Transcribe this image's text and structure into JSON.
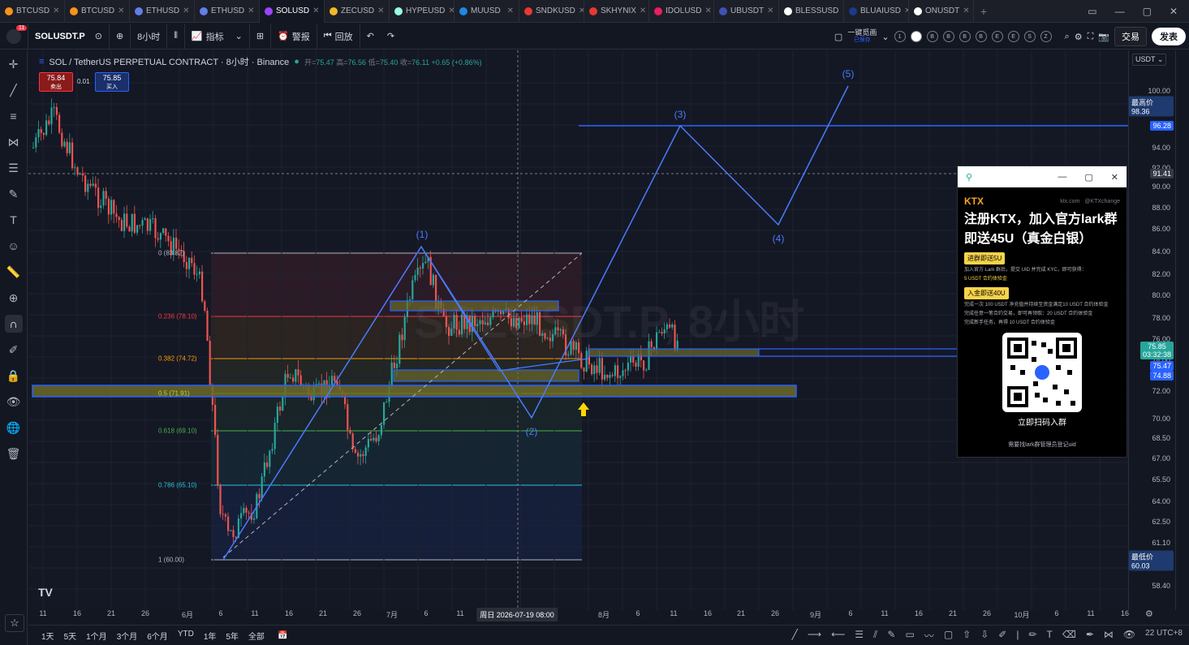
{
  "tabs": [
    {
      "label": "BTCUSD",
      "color": "#f7931a"
    },
    {
      "label": "BTCUSD",
      "color": "#f7931a"
    },
    {
      "label": "ETHUSD",
      "color": "#627eea"
    },
    {
      "label": "ETHUSD",
      "color": "#627eea"
    },
    {
      "label": "SOLUSD",
      "color": "#9945ff"
    },
    {
      "label": "ZECUSD",
      "color": "#f4b728"
    },
    {
      "label": "HYPEUSD",
      "color": "#97fce4"
    },
    {
      "label": "MUUSD",
      "color": "#1e88e5"
    },
    {
      "label": "SNDKUSD",
      "color": "#e53935"
    },
    {
      "label": "SKHYNIX",
      "color": "#e53935"
    },
    {
      "label": "IDOLUSD",
      "color": "#e91e63"
    },
    {
      "label": "UBUSDT",
      "color": "#3f51b5"
    },
    {
      "label": "BLESSUSD",
      "color": "#ffffff"
    },
    {
      "label": "BLUAIUSD",
      "color": "#1e3a8a"
    },
    {
      "label": "ONUSDT",
      "color": "#ffffff"
    }
  ],
  "toolbar": {
    "avatar_badge": "11",
    "symbol": "SOLUSDT.P",
    "interval": "8小时",
    "indicators": "指标",
    "alert": "警报",
    "replay": "回放",
    "layout_name": "一键觅画",
    "layout_sub": "已保存",
    "trade": "交易",
    "publish": "发表"
  },
  "legend": {
    "title": "SOL / TetherUS PERPETUAL CONTRACT · 8小时 · Binance",
    "open_label": "开=",
    "open": "75.47",
    "high_label": "高=",
    "high": "76.56",
    "low_label": "低=",
    "low": "75.40",
    "close_label": "收=",
    "close": "76.11",
    "change": "+0.65 (+0.86%)"
  },
  "price_boxes": {
    "sell_price": "75.84",
    "sell_label": "卖出",
    "spread": "0.01",
    "buy_price": "75.85",
    "buy_label": "买入"
  },
  "fib_levels": [
    {
      "ratio": "0 (83.82)",
      "color": "#b2b5be"
    },
    {
      "ratio": "0.236 (78.10)",
      "color": "#f23645"
    },
    {
      "ratio": "0.382 (74.72)",
      "color": "#ff9800"
    },
    {
      "ratio": "0.5 (71.91)",
      "color": "#c6cf36"
    },
    {
      "ratio": "0.618 (69.10)",
      "color": "#4caf50"
    },
    {
      "ratio": "0.786 (65.10)",
      "color": "#26c6da"
    },
    {
      "ratio": "1 (60.00)",
      "color": "#b2b5be"
    }
  ],
  "waves": [
    "(1)",
    "(2)",
    "(3)",
    "(4)",
    "(5)"
  ],
  "watermark": "SOLUSDT.P, 8小时",
  "price_axis": {
    "currency": "USDT",
    "labels": [
      "100.00",
      "94.00",
      "92.00",
      "90.00",
      "88.00",
      "86.00",
      "84.00",
      "82.00",
      "80.00",
      "78.00",
      "76.00",
      "74.00",
      "72.00",
      "70.00",
      "68.50",
      "67.00",
      "65.50",
      "64.00",
      "62.50",
      "61.10",
      "58.40"
    ],
    "highest_label": "最高价",
    "highest_value": "98.36",
    "level_line": "96.28",
    "crosshair": "91.41",
    "last_price": "75.85",
    "countdown": "03:32:38",
    "p2": "75.47",
    "p3": "74.88",
    "lowest_label": "最低价",
    "lowest_value": "60.03"
  },
  "time_axis": {
    "labels": [
      "11",
      "16",
      "21",
      "26",
      "6月",
      "6",
      "11",
      "16",
      "21",
      "26",
      "7月",
      "6",
      "11",
      "8月",
      "6",
      "11",
      "16",
      "21",
      "26",
      "9月",
      "6",
      "11",
      "16",
      "21",
      "26",
      "10月",
      "6",
      "11",
      "16"
    ],
    "cursor": "周日 2026-07-19   08:00"
  },
  "bottom": {
    "ranges": [
      "1天",
      "5天",
      "1个月",
      "3个月",
      "6个月",
      "YTD",
      "1年",
      "5年",
      "全部"
    ],
    "timezone": "22 UTC+8"
  },
  "ad": {
    "brand": "KTX",
    "site": "ktx.com",
    "handle": "@KTXchange",
    "title_line1": "注册KTX，加入官方lark群",
    "title_line2": "即送45U（真金白银）",
    "chip1": "进群即送5U",
    "text1": "加入官方 Lark 群后，提交 UID 并完成 KYC，即可获得：",
    "text1b": "5 USDT 合约体验金",
    "chip2": "入金即送40U",
    "text2": "完成一次 100 USDT 净充值并持续至资金满足10 USDT 合约体验金",
    "text2b": "完成任意一笔合约交易，即可再领取：20 USDT 合约体验金",
    "text3": "完成新手任务，再得 10 USDT 合约体验金",
    "qr_caption": "立即扫码入群",
    "footer": "需要找lark群管理员登记uid"
  },
  "colors": {
    "bg": "#141824",
    "up": "#26a69a",
    "down": "#ef5350",
    "wave": "#4a7bff",
    "zone": "#6b6a2a"
  }
}
